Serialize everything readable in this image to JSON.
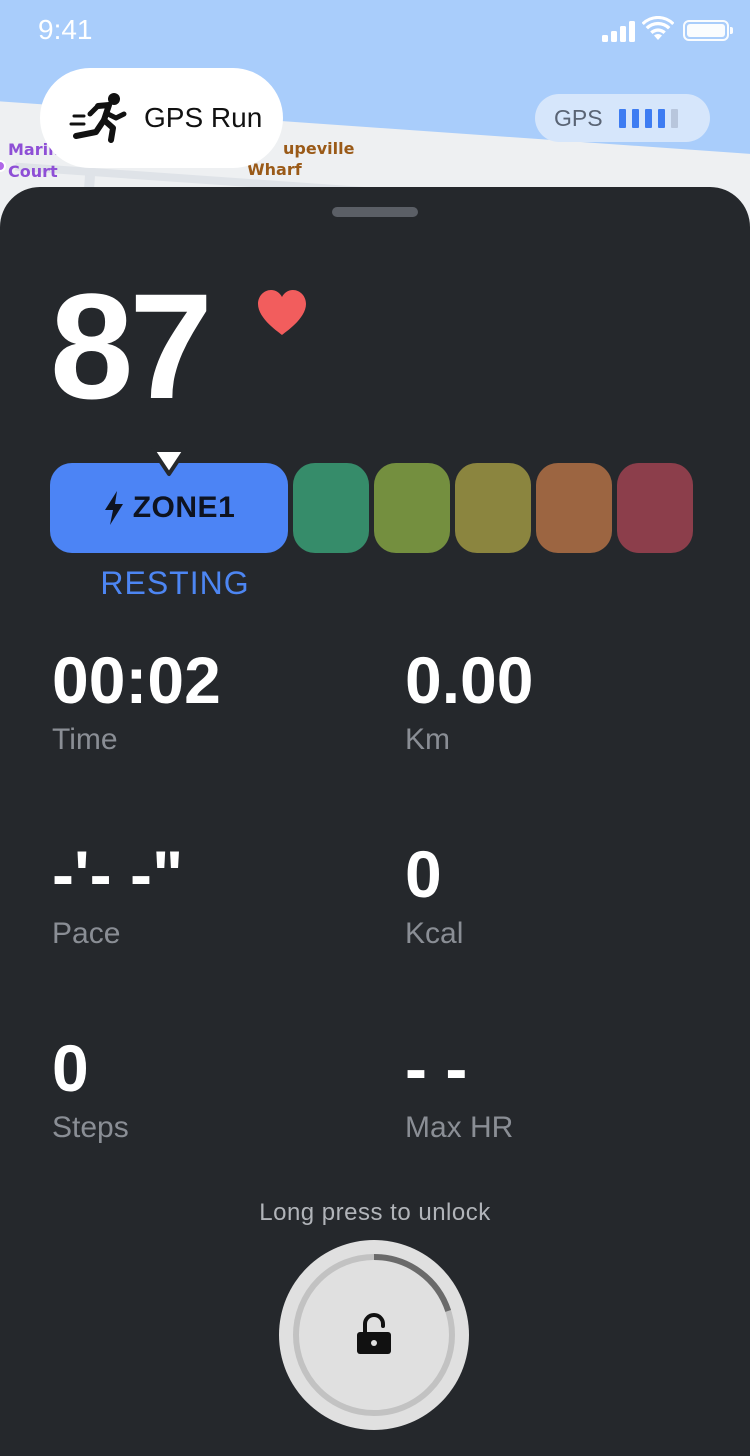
{
  "status_bar": {
    "time": "9:41"
  },
  "map": {
    "labels": [
      {
        "text": "Marin",
        "tone": "purple"
      },
      {
        "text": "Court",
        "tone": "purple"
      },
      {
        "text": "upeville",
        "tone": "brown"
      },
      {
        "text": "Wharf",
        "tone": "brown"
      }
    ]
  },
  "header": {
    "mode_label": "GPS Run",
    "mode_icon": "runner-icon",
    "gps_label": "GPS",
    "gps_signal": {
      "bars_on": 4,
      "bars_total": 5
    }
  },
  "heart_rate": {
    "value": "87",
    "icon": "heart-icon",
    "icon_color": "#f25d5d"
  },
  "zones": {
    "active_label": "ZONE1",
    "active_icon": "bolt-icon",
    "active_color": "#4c84f5",
    "status": "RESTING",
    "other_colors": [
      "#368c6a",
      "#748f3f",
      "#8b853f",
      "#9c6541",
      "#8c3e4b"
    ]
  },
  "metrics": [
    {
      "value": "00:02",
      "label": "Time"
    },
    {
      "value": "0.00",
      "label": "Km"
    },
    {
      "value": "-'- -\"",
      "label": "Pace"
    },
    {
      "value": "0",
      "label": "Kcal"
    },
    {
      "value": "0",
      "label": "Steps"
    },
    {
      "value": "- -",
      "label": "Max HR"
    }
  ],
  "unlock": {
    "hint": "Long press to unlock",
    "icon": "unlock-icon",
    "progress": 0.2
  }
}
